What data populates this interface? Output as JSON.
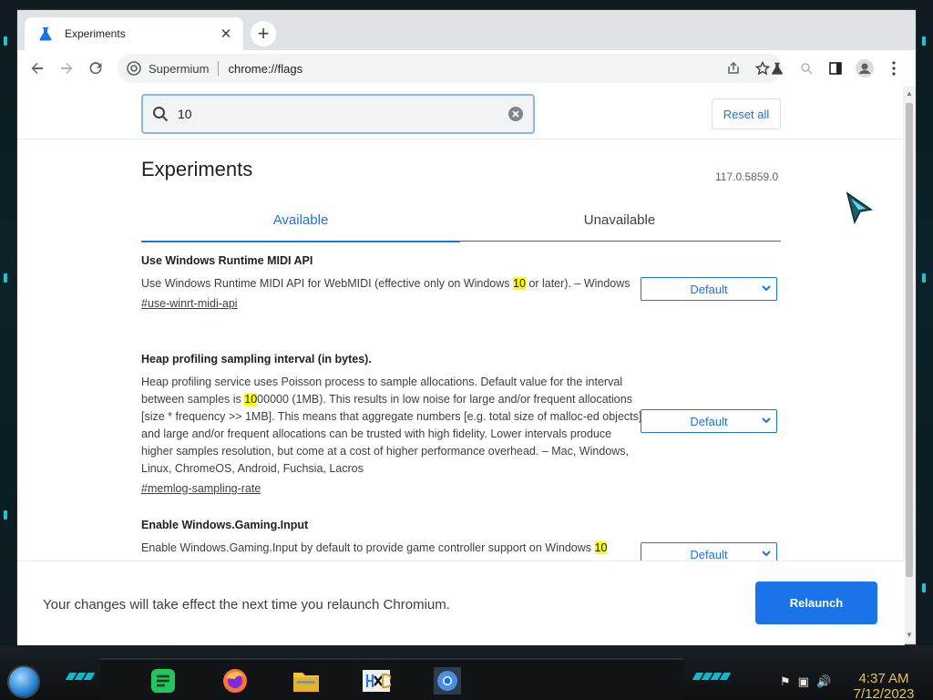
{
  "browser": {
    "tab_title": "Experiments",
    "new_tab_symbol": "+",
    "close_symbol": "✕",
    "omnibox": {
      "site_chip": "Supermium",
      "url": "chrome://flags"
    }
  },
  "flags": {
    "search_value": "10",
    "reset_label": "Reset all",
    "heading": "Experiments",
    "version": "117.0.5859.0",
    "tabs": [
      {
        "label": "Available",
        "active": true
      },
      {
        "label": "Unavailable",
        "active": false
      }
    ],
    "experiments": [
      {
        "name": "Use Windows Runtime MIDI API",
        "desc_pre": "Use Windows Runtime MIDI API for WebMIDI (effective only on Windows ",
        "desc_mark": "10",
        "desc_post": " or later). – Windows",
        "link": "#use-winrt-midi-api",
        "select": "Default"
      },
      {
        "name": "Heap profiling sampling interval (in bytes).",
        "desc_pre": "Heap profiling service uses Poisson process to sample allocations. Default value for the interval between samples is ",
        "desc_mark": "10",
        "desc_post": "00000 (1MB). This results in low noise for large and/or frequent allocations [size * frequency >> 1MB]. This means that aggregate numbers [e.g. total size of malloc-ed objects] and large and/or frequent allocations can be trusted with high fidelity. Lower intervals produce higher samples resolution, but come at a cost of higher performance overhead. – Mac, Windows, Linux, ChromeOS, Android, Fuchsia, Lacros",
        "link": "#memlog-sampling-rate",
        "select": "Default"
      },
      {
        "name": "Enable Windows.Gaming.Input",
        "desc_pre": "Enable Windows.Gaming.Input by default to provide game controller support on Windows ",
        "desc_mark": "10",
        "desc_post": "",
        "link": "",
        "select": "Default"
      }
    ],
    "footer_message": "Your changes will take effect the next time you relaunch Chromium.",
    "relaunch_label": "Relaunch"
  },
  "taskbar": {
    "time": "4:37 AM",
    "date": "7/12/2023"
  },
  "colors": {
    "accent": "#1a73e8",
    "highlight": "#ffff00",
    "clock": "#e8c24a"
  }
}
